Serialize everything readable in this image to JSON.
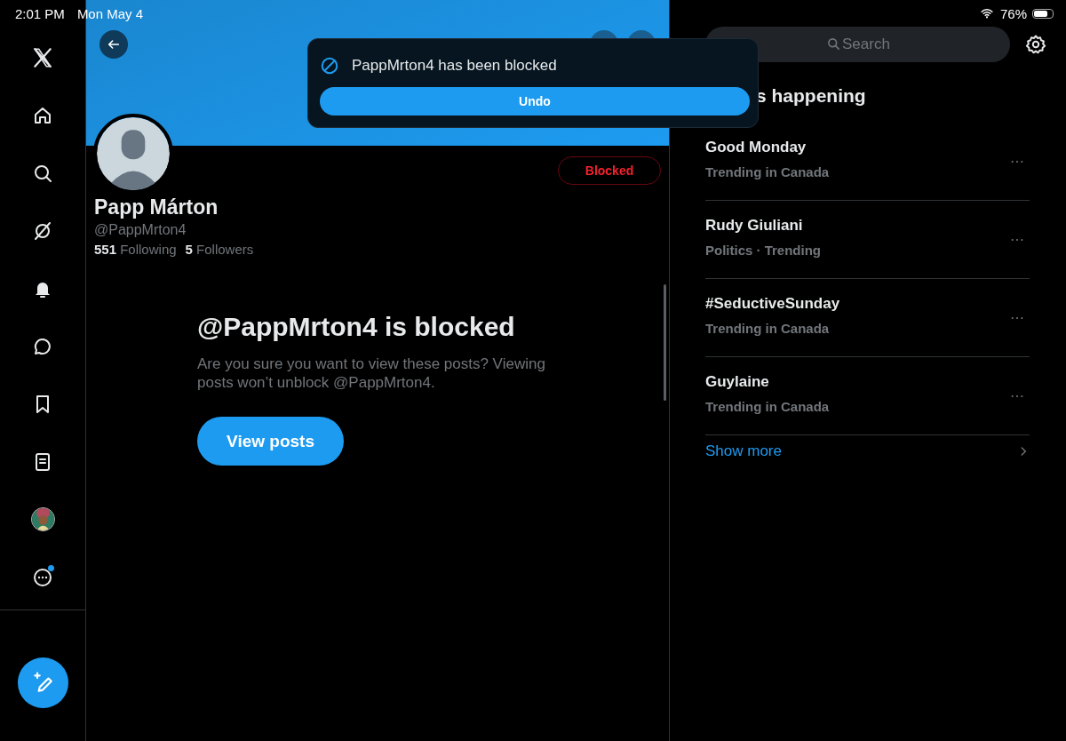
{
  "status_bar": {
    "time": "2:01 PM",
    "date": "Mon May 4",
    "battery": "76%"
  },
  "sidebar": {
    "items": [
      {
        "kind": "logo",
        "selected": false,
        "dot": false
      },
      {
        "kind": "home",
        "selected": false,
        "dot": false
      },
      {
        "kind": "search",
        "selected": false,
        "dot": false
      },
      {
        "kind": "grok",
        "selected": false,
        "dot": false
      },
      {
        "kind": "bell",
        "selected": false,
        "dot": false
      },
      {
        "kind": "chat",
        "selected": false,
        "dot": false
      },
      {
        "kind": "bookmark",
        "selected": false,
        "dot": false
      },
      {
        "kind": "list",
        "selected": false,
        "dot": false
      },
      {
        "kind": "avatar",
        "selected": false,
        "dot": false
      },
      {
        "kind": "more",
        "selected": false,
        "dot": true
      }
    ]
  },
  "profile": {
    "name": "Papp Márton",
    "handle": "@PappMrton4",
    "following_count": "551",
    "following_label": "Following",
    "followers_count": "5",
    "followers_label": "Followers",
    "status_button": "Blocked",
    "blocked_title": "@PappMrton4 is blocked",
    "blocked_text": "Are you sure you want to view these posts? Viewing posts won’t unblock @PappMrton4.",
    "view_button": "View posts"
  },
  "toast": {
    "message": "PappMrton4 has been blocked",
    "action": "Undo"
  },
  "right": {
    "search": {
      "placeholder": "Search"
    },
    "heading": "s happening",
    "trends": [
      {
        "title": "Good Monday",
        "subtitle": "Trending in Canada"
      },
      {
        "title": "Rudy Giuliani",
        "subtitle": "Politics · Trending"
      },
      {
        "title": "#SeductiveSunday",
        "subtitle": "Trending in Canada"
      },
      {
        "title": "Guylaine",
        "subtitle": "Trending in Canada"
      }
    ],
    "show_more": "Show more"
  }
}
